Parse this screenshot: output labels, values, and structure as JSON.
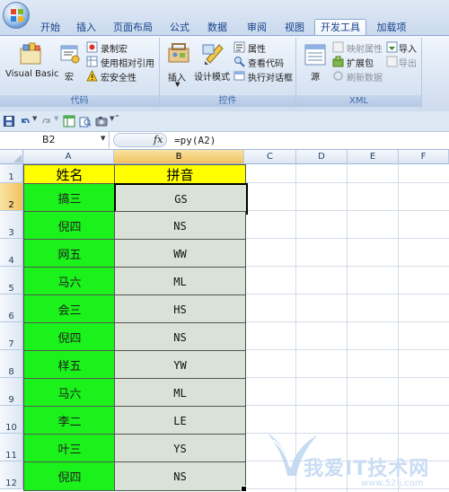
{
  "ribbon": {
    "tabs": [
      "开始",
      "插入",
      "页面布局",
      "公式",
      "数据",
      "审阅",
      "视图",
      "开发工具",
      "加载项"
    ],
    "active_tab": "开发工具",
    "groups": {
      "code": {
        "label": "代码",
        "visual_basic": "Visual Basic",
        "macros": "宏",
        "record_macro": "录制宏",
        "relative_ref": "使用相对引用",
        "macro_security": "宏安全性"
      },
      "controls": {
        "label": "控件",
        "insert": "插入",
        "design_mode": "设计模式",
        "properties": "属性",
        "view_code": "查看代码",
        "run_dialog": "执行对话框"
      },
      "xml": {
        "label": "XML",
        "source": "源",
        "map_properties": "映射属性",
        "expansion_packs": "扩展包",
        "refresh_data": "刷新数据",
        "import": "导入",
        "export": "导出"
      }
    }
  },
  "formula_bar": {
    "name_box": "B2",
    "fx": "fx",
    "formula": "=py(A2)"
  },
  "sheet": {
    "columns": [
      "A",
      "B",
      "C",
      "D",
      "E",
      "F"
    ],
    "selected_column": "B",
    "selected_row": "2",
    "header": [
      "姓名",
      "拼音"
    ],
    "rows": [
      {
        "num": "1"
      },
      {
        "num": "2",
        "a": "搞三",
        "b": "GS"
      },
      {
        "num": "3",
        "a": "倪四",
        "b": "NS"
      },
      {
        "num": "4",
        "a": "网五",
        "b": "WW"
      },
      {
        "num": "5",
        "a": "马六",
        "b": "ML"
      },
      {
        "num": "6",
        "a": "会三",
        "b": "HS"
      },
      {
        "num": "7",
        "a": "倪四",
        "b": "NS"
      },
      {
        "num": "8",
        "a": "样五",
        "b": "YW"
      },
      {
        "num": "9",
        "a": "马六",
        "b": "ML"
      },
      {
        "num": "10",
        "a": "李二",
        "b": "LE"
      },
      {
        "num": "11",
        "a": "叶三",
        "b": "YS"
      },
      {
        "num": "12",
        "a": "倪四",
        "b": "NS"
      }
    ]
  },
  "watermark": {
    "text": "我爱IT技术网",
    "url": "www.52ij.com"
  },
  "colors": {
    "name_fill": "#1bf21b",
    "pinyin_fill": "#d9e2d6",
    "header_fill": "#ffff00",
    "selection_border": "#000000"
  }
}
